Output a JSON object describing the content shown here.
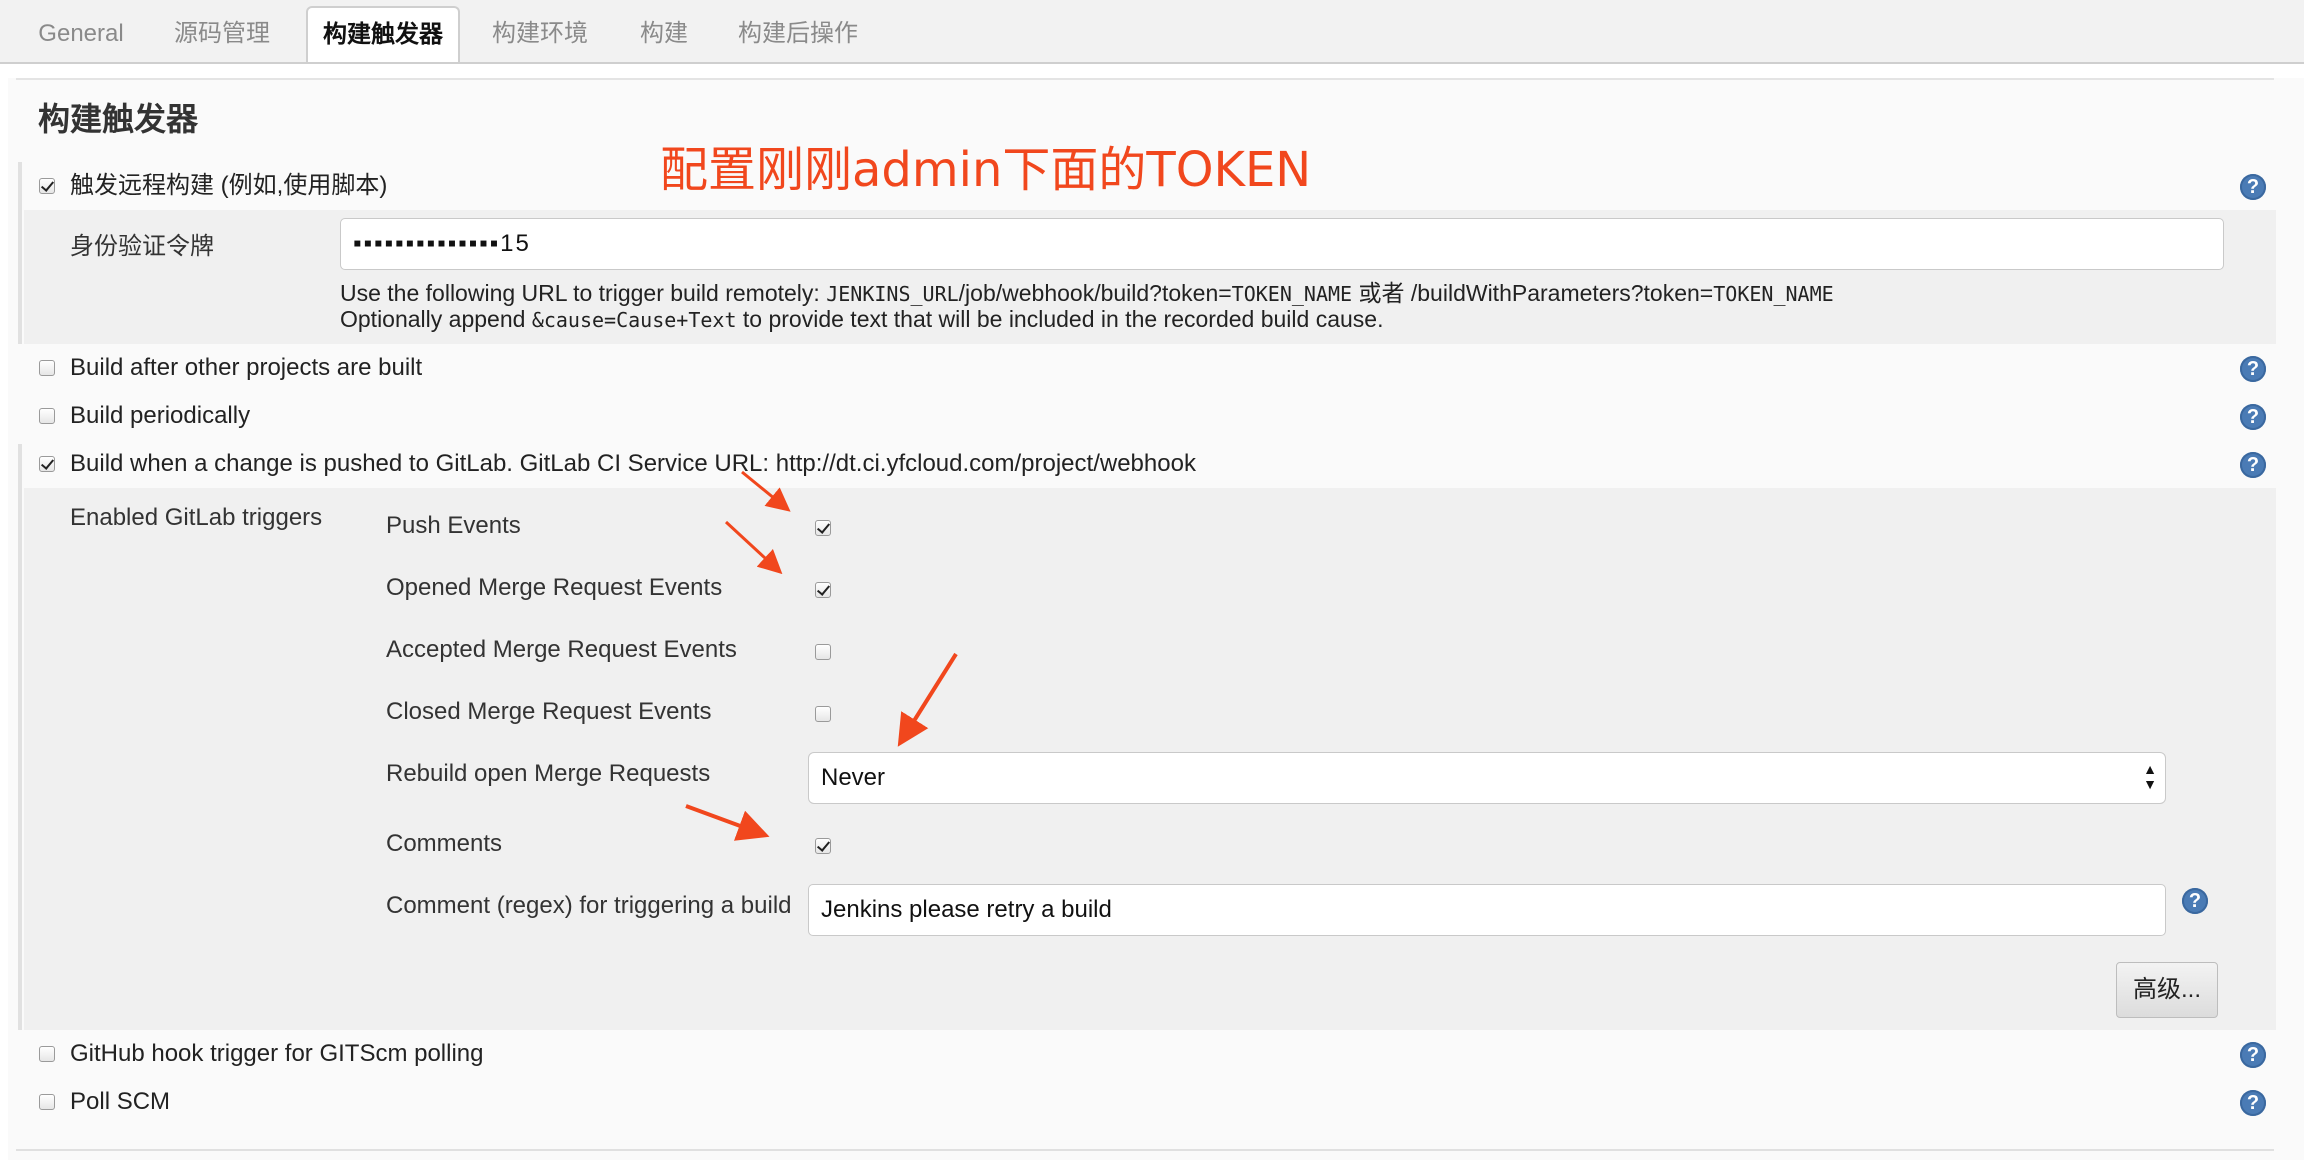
{
  "tabs": [
    "General",
    "源码管理",
    "构建触发器",
    "构建环境",
    "构建",
    "构建后操作"
  ],
  "active_tab": "构建触发器",
  "section_title": "构建触发器",
  "annotation": "配置刚刚admin下面的TOKEN",
  "remote_build": {
    "label": "触发远程构建 (例如,使用脚本)",
    "checked": true,
    "token_label": "身份验证令牌",
    "token_value": "▪▪▪▪▪▪▪▪▪▪▪▪▪▪15",
    "hint1_pre": "Use the following URL to trigger build remotely: ",
    "hint1_code1": "JENKINS_URL",
    "hint1_mid": "/job/webhook/build?token=",
    "hint1_code2": "TOKEN_NAME",
    "hint1_or": " 或者 /buildWithParameters?token=",
    "hint1_code3": "TOKEN_NAME",
    "hint2_pre": "Optionally append ",
    "hint2_code": "&cause=Cause+Text",
    "hint2_post": " to provide text that will be included in the recorded build cause."
  },
  "options": {
    "after_other": "Build after other projects are built",
    "periodically": "Build periodically",
    "gitlab": "Build when a change is pushed to GitLab. GitLab CI Service URL: http://dt.ci.yfcloud.com/project/webhook",
    "github_hook": "GitHub hook trigger for GITScm polling",
    "poll_scm": "Poll SCM"
  },
  "gitlab_triggers": {
    "label": "Enabled GitLab triggers",
    "push_events": "Push Events",
    "opened_mr": "Opened Merge Request Events",
    "accepted_mr": "Accepted Merge Request Events",
    "closed_mr": "Closed Merge Request Events",
    "rebuild_label": "Rebuild open Merge Requests",
    "rebuild_value": "Never",
    "comments": "Comments",
    "comment_regex_label": "Comment (regex) for triggering a build",
    "comment_regex_value": "Jenkins please retry a build",
    "advanced_button": "高级..."
  },
  "help_glyph": "?",
  "colors": {
    "annotation": "#f1471d",
    "help": "#4a7bb5"
  }
}
